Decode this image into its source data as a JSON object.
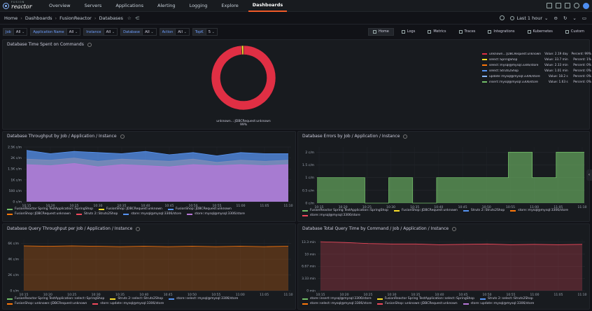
{
  "brand": {
    "line1": "FUSION",
    "line2": "reactor"
  },
  "nav": {
    "items": [
      "Overview",
      "Servers",
      "Applications",
      "Alerting",
      "Logging",
      "Explore",
      "Dashboards"
    ],
    "active": "Dashboards"
  },
  "breadcrumb": {
    "items": [
      "Home",
      "Dashboards",
      "FusionReactor",
      "Databases"
    ]
  },
  "time_picker": {
    "label": "Last 1 hour"
  },
  "variables": [
    {
      "label": "Job",
      "value": "All"
    },
    {
      "label": "Application Name",
      "value": "All"
    },
    {
      "label": "Instance",
      "value": "All"
    },
    {
      "label": "Database",
      "value": "All"
    },
    {
      "label": "Action",
      "value": "All"
    },
    {
      "label": "TopK",
      "value": "5"
    }
  ],
  "dashboard_links": [
    "Home",
    "Logs",
    "Metrics",
    "Traces",
    "Integrations",
    "Kubernetes",
    "Custom"
  ],
  "panels": {
    "time_spent": {
      "title": "Database Time Spent on Commands",
      "donut_label": "unknown...:JDBCRequest:unknown",
      "donut_pct": "99%",
      "legend": [
        {
          "name": "unknown...:JDBCRequest:unknown",
          "value": "Value: 2.19 day",
          "percent": "Percent: 99%",
          "color": "#e02f44"
        },
        {
          "name": "select::SpringShop",
          "value": "Value: 33.7 min",
          "percent": "Percent: 1%",
          "color": "#fade2a"
        },
        {
          "name": "select::mysql@mysql:3306/store",
          "value": "Value: 2.33 min",
          "percent": "Percent: 0%",
          "color": "#ff780a"
        },
        {
          "name": "select::Struts2Shop",
          "value": "Value: 1.01 min",
          "percent": "Percent: 0%",
          "color": "#5794f2"
        },
        {
          "name": "update::mysql@mysql:3306/store",
          "value": "Value: 18.2 s",
          "percent": "Percent: 0%",
          "color": "#8ab8ff"
        },
        {
          "name": "insert::mysql@mysql:3306/store",
          "value": "Value: 1.63 s",
          "percent": "Percent: 0%",
          "color": "#73bf69"
        }
      ]
    },
    "throughput": {
      "title": "Database Throughput by Job / Application / Instance",
      "legend": [
        {
          "name": "FusionReactor Spring TestApplication::SpringShop",
          "color": "#73bf69"
        },
        {
          "name": "FusionShop::JDBCRequest:unknown",
          "color": "#fade2a"
        },
        {
          "name": "FusionShop::JDBCRequest:unknown",
          "color": "#5794f2"
        },
        {
          "name": "FusionShop::JDBCRequest:unknown",
          "color": "#ff780a"
        },
        {
          "name": "Struts 2::Struts2Shop",
          "color": "#f2495c"
        },
        {
          "name": "store::mysql@mysql:3306/store",
          "color": "#5794f2"
        },
        {
          "name": "store::mysql@mysql:3306/store",
          "color": "#b877d9"
        }
      ]
    },
    "errors": {
      "title": "Database Errors by Job / Application / Instance",
      "legend": [
        {
          "name": "FusionReactor Spring TestApplication::SpringShop",
          "color": "#73bf69"
        },
        {
          "name": "FusionShop::JDBCRequest:unknown",
          "color": "#fade2a"
        },
        {
          "name": "Struts 2::Struts2Shop",
          "color": "#5794f2"
        },
        {
          "name": "store::mysql@mysql:3306/store",
          "color": "#ff780a"
        },
        {
          "name": "store::mysql@mysql:3306/store",
          "color": "#f2495c"
        }
      ]
    },
    "query_throughput": {
      "title": "Database Query Throughput per Job / Application / Instance",
      "legend": [
        {
          "name": "FusionReactor Spring TestApplication::select::SpringShop",
          "color": "#73bf69"
        },
        {
          "name": "Struts 2::select::Struts2Shop",
          "color": "#fade2a"
        },
        {
          "name": "store::select::mysql@mysql:3306/store",
          "color": "#5794f2"
        },
        {
          "name": "FusionShop::unknown::JDBCRequest:unknown",
          "color": "#ff780a"
        },
        {
          "name": "store::update::mysql@mysql:3306/store",
          "color": "#f2495c"
        }
      ]
    },
    "query_time": {
      "title": "Database Total Query Time by Command / Job / Application / Instance",
      "legend": [
        {
          "name": "store::insert::mysql@mysql:3306/store",
          "color": "#73bf69"
        },
        {
          "name": "FusionReactor Spring TestApplication::select::SpringShop",
          "color": "#fade2a"
        },
        {
          "name": "Struts 2::select::Struts2Shop",
          "color": "#5794f2"
        },
        {
          "name": "store::select::mysql@mysql:3306/store",
          "color": "#ff780a"
        },
        {
          "name": "FusionShop::unknown::JDBCRequest:unknown",
          "color": "#f2495c"
        },
        {
          "name": "store::update::mysql@mysql:3306/store",
          "color": "#b877d9"
        }
      ]
    }
  },
  "chart_data": [
    {
      "type": "pie",
      "title": "Database Time Spent on Commands",
      "categories": [
        "unknown...:JDBCRequest:unknown",
        "select::SpringShop",
        "select::mysql@mysql:3306/store",
        "select::Struts2Shop",
        "update::mysql@mysql:3306/store",
        "insert::mysql@mysql:3306/store"
      ],
      "values": [
        99,
        1,
        0,
        0,
        0,
        0
      ],
      "colors": [
        "#e02f44",
        "#fade2a",
        "#ff780a",
        "#5794f2",
        "#8ab8ff",
        "#73bf69"
      ]
    },
    {
      "type": "area",
      "title": "Database Throughput by Job / Application / Instance",
      "x": [
        "10:15",
        "10:20",
        "10:25",
        "10:30",
        "10:35",
        "10:40",
        "10:45",
        "10:50",
        "10:55",
        "11:00",
        "11:05",
        "11:10"
      ],
      "yticks": [
        "0 c/m",
        "500 c/m",
        "1K c/m",
        "1.5K c/m",
        "2K c/m",
        "2.5K c/m"
      ],
      "ylim": [
        0,
        2500
      ],
      "series": [
        {
          "name": "FusionShop::JDBCRequest:unknown",
          "color": "#ff780a",
          "values": [
            1950,
            1900,
            2000,
            1850,
            1950,
            1900,
            1850,
            1950,
            1800,
            1900,
            1850,
            1900
          ]
        },
        {
          "name": "FusionShop::JDBCRequest:unknown",
          "color": "#5794f2",
          "values": [
            2350,
            2200,
            2300,
            2250,
            2200,
            2300,
            2150,
            2250,
            2100,
            2250,
            2200,
            2200
          ]
        },
        {
          "name": "store::mysql@mysql:3306/store",
          "color": "#b877d9",
          "values": [
            1700,
            1650,
            1750,
            1600,
            1700,
            1650,
            1600,
            1700,
            1650,
            1700,
            1650,
            1700
          ]
        }
      ]
    },
    {
      "type": "area",
      "title": "Database Errors by Job / Application / Instance",
      "x": [
        "10:15",
        "10:20",
        "10:25",
        "10:30",
        "10:35",
        "10:40",
        "10:45",
        "10:50",
        "10:55",
        "11:00",
        "11:05",
        "11:10"
      ],
      "yticks": [
        "0 c/m",
        "0.5 c/m",
        "1 c/m",
        "1.5 c/m",
        "2 c/m"
      ],
      "ylim": [
        0,
        2.2
      ],
      "series": [
        {
          "name": "FusionShop::JDBCRequest:unknown",
          "color": "#73bf69",
          "values": [
            1,
            1,
            0,
            1,
            0,
            1,
            1,
            1,
            2,
            1,
            2,
            2
          ]
        }
      ]
    },
    {
      "type": "line",
      "title": "Database Query Throughput per Job / Application / Instance",
      "x": [
        "10:15",
        "10:20",
        "10:25",
        "10:30",
        "10:35",
        "10:40",
        "10:45",
        "10:50",
        "10:55",
        "11:00",
        "11:05",
        "11:10"
      ],
      "yticks": [
        "0 c/m",
        "2K c/m",
        "4K c/m",
        "6K c/m"
      ],
      "ylim": [
        0,
        6500
      ],
      "series": [
        {
          "name": "FusionShop::unknown::JDBCRequest:unknown",
          "color": "#ff780a",
          "values": [
            5700,
            5650,
            5700,
            5650,
            5600,
            5650,
            5600,
            5650,
            5600,
            5650,
            5600,
            5650
          ]
        }
      ]
    },
    {
      "type": "line",
      "title": "Database Total Query Time by Command / Job / Application / Instance",
      "x": [
        "10:15",
        "10:20",
        "10:25",
        "10:30",
        "10:35",
        "10:40",
        "10:45",
        "10:50",
        "10:55",
        "11:00",
        "11:05",
        "11:10"
      ],
      "yticks": [
        "0 min",
        "3.33 min",
        "6.67 min",
        "10 min",
        "13.3 min"
      ],
      "ylim": [
        0,
        14
      ],
      "series": [
        {
          "name": "FusionShop::unknown::JDBCRequest:unknown",
          "color": "#f2495c",
          "values": [
            13.4,
            13.2,
            12.9,
            12.8,
            12.8,
            12.6,
            12.7,
            12.8,
            12.6,
            12.7,
            12.6,
            12.7
          ]
        }
      ]
    }
  ]
}
